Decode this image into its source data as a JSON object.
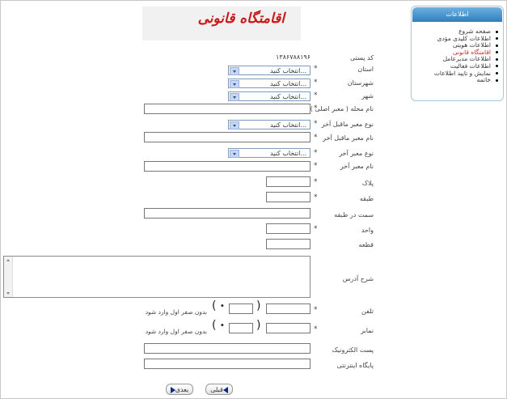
{
  "header": {
    "title": "اقامتگاه قانونی"
  },
  "panel": {
    "title": "اطلاعات",
    "items": [
      {
        "label": "صفحه شروع",
        "active": false
      },
      {
        "label": "اطلاعات کلیدی مؤدی",
        "active": false
      },
      {
        "label": "اطلاعات هویتی",
        "active": false
      },
      {
        "label": "اقامتگاه قانونی",
        "active": true
      },
      {
        "label": "اطلاعات مدیرعامل",
        "active": false
      },
      {
        "label": "اطلاعات فعالیت",
        "active": false
      },
      {
        "label": "نمایش و تایید اطلاعات",
        "active": false
      },
      {
        "label": "خاتمه",
        "active": false
      }
    ],
    "active_color": "#d2232a"
  },
  "form": {
    "postal_code": {
      "label": "کد پستی",
      "value": "۱۳۸۶۷۸۸۱۹۶"
    },
    "province": {
      "label": "استان",
      "selected": "...انتخاب کنید"
    },
    "county": {
      "label": "شهرستان",
      "selected": "...انتخاب کنید"
    },
    "city": {
      "label": "شهر",
      "selected": "...انتخاب کنید"
    },
    "neighborhood": {
      "label": "نام محله ( معبر اصلی )",
      "value": ""
    },
    "last_minor_type": {
      "label": "نوع معبر ماقبل آخر",
      "selected": "...انتخاب کنید"
    },
    "last_minor_name": {
      "label": "نام معبر ماقبل آخر",
      "value": ""
    },
    "last_type": {
      "label": "نوع معبر آخر",
      "selected": "...انتخاب کنید"
    },
    "last_name": {
      "label": "نام معبر آخر",
      "value": ""
    },
    "plaque": {
      "label": "پلاک",
      "value": ""
    },
    "floor": {
      "label": "طبقه",
      "value": ""
    },
    "floor_side": {
      "label": "سمت در طبقه",
      "value": ""
    },
    "unit": {
      "label": "واحد",
      "value": ""
    },
    "lot": {
      "label": "قطعه",
      "value": ""
    },
    "address": {
      "label": "شرح آدرس",
      "value": ""
    },
    "phone": {
      "label": "تلفن",
      "hint": "بدون صفر اول وارد شود",
      "open_paren": "(",
      "close_paren": ")"
    },
    "fax": {
      "label": "نمابر",
      "hint": "بدون صفر اول وارد شود",
      "open_paren": "(",
      "close_paren": ")"
    },
    "email": {
      "label": "پست الکترونیک",
      "value": ""
    },
    "website": {
      "label": "پایگاه اینترنتی",
      "value": ""
    },
    "required_mark": "*"
  },
  "buttons": {
    "prev_label": "قبلی",
    "next_label": "بعدی"
  }
}
